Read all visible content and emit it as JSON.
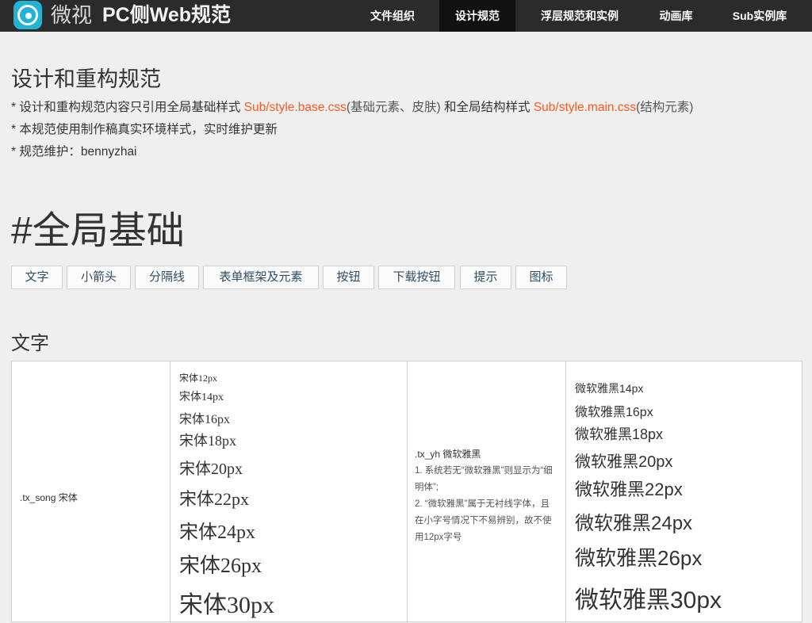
{
  "header": {
    "brand": "微视",
    "title": "PC侧Web规范",
    "nav": [
      {
        "label": "文件组织",
        "active": false
      },
      {
        "label": "设计规范",
        "active": true
      },
      {
        "label": "浮层规范和实例",
        "active": false
      },
      {
        "label": "动画库",
        "active": false
      },
      {
        "label": "Sub实例库",
        "active": false
      }
    ],
    "colors": {
      "bar": "#2b2b2b",
      "active_tab": "#111111",
      "logo": "#1fb3d4"
    }
  },
  "intro": {
    "heading": "设计和重构规范",
    "line1": {
      "p1": "* 设计和重构规范内容只引用全局基础样式 ",
      "file1": "Sub/style.base.css",
      "paren1": "(基础元素、皮肤)",
      "p2": " 和全局结构样式 ",
      "file2": "Sub/style.main.css",
      "paren2": "(结构元素)"
    },
    "line2": "* 本规范使用制作稿真实环境样式，实时维护更新",
    "line3": "* 规范维护：bennyzhai",
    "link_color": "#ff5a1f"
  },
  "global": {
    "heading": "#全局基础",
    "tags": [
      "文字",
      "小箭头",
      "分隔线",
      "表单框架及元素",
      "按钮",
      "下载按钮",
      "提示",
      "图标"
    ]
  },
  "section": {
    "heading": "文字",
    "song": {
      "class_label": ".tx_song 宋体",
      "samples": [
        "宋体12px",
        "宋体14px",
        "宋体16px",
        "宋体18px",
        "宋体20px",
        "宋体22px",
        "宋体24px",
        "宋体26px",
        "宋体30px"
      ]
    },
    "yh": {
      "title": ".tx_yh 微软雅黑",
      "notes": [
        "1. 系统若无“微软雅黑”则显示为“细明体”;",
        "2. “微软雅黑”属于无衬线字体，且在小字号情况下不易辨别，故不使用12px字号"
      ],
      "samples": [
        "微软雅黑14px",
        "微软雅黑16px",
        "微软雅黑18px",
        "微软雅黑20px",
        "微软雅黑22px",
        "微软雅黑24px",
        "微软雅黑26px",
        "微软雅黑30px"
      ]
    }
  }
}
